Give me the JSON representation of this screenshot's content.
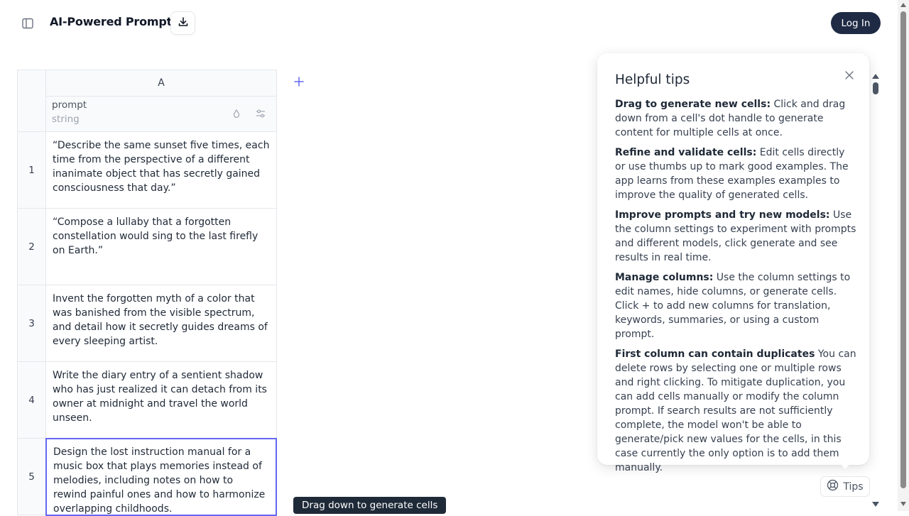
{
  "header": {
    "title": "AI-Powered Prompts",
    "login_label": "Log In"
  },
  "grid": {
    "column": {
      "letter": "A",
      "name": "prompt",
      "type": "string"
    },
    "rows": [
      {
        "num": "1",
        "text": "“Describe the same sunset five times, each time from the perspective of a different inanimate object that has secretly gained consciousness that day.”"
      },
      {
        "num": "2",
        "text": "“Compose a lullaby that a forgotten constellation would sing to the last firefly on Earth.”"
      },
      {
        "num": "3",
        "text": "Invent the forgotten myth of a color that was banished from the visible spectrum, and detail how it secretly guides dreams of every sleeping artist."
      },
      {
        "num": "4",
        "text": "Write the diary entry of a sentient shadow who has just realized it can detach from its owner at midnight and travel the world unseen."
      },
      {
        "num": "5",
        "text": "Design the lost instruction manual for a music box that plays memories instead of melodies, including notes on how to rewind painful ones and how to harmonize overlapping childhoods."
      }
    ],
    "selected_row": 5
  },
  "tooltip": "Drag down to generate cells",
  "tips": {
    "title": "Helpful tips",
    "items": [
      {
        "heading": "Drag to generate new cells:",
        "text": " Click and drag down from a cell's dot handle to generate content for multiple cells at once."
      },
      {
        "heading": "Refine and validate cells:",
        "text": " Edit cells directly or use thumbs up to mark good examples. The app learns from these examples examples to improve the quality of generated cells."
      },
      {
        "heading": "Improve prompts and try new models:",
        "text": " Use the column settings to experiment with prompts and different models, click generate and see results in real time."
      },
      {
        "heading": "Manage columns:",
        "text": " Use the column settings to edit names, hide columns, or generate cells. Click + to add new columns for translation, keywords, summaries, or using a custom prompt."
      },
      {
        "heading": "First column can contain duplicates",
        "text": " You can delete rows by selecting one or multiple rows and right clicking. To mitigate duplication, you can add cells manually or modify the column prompt. If search results are not sufficiently complete, the model won't be able to generate/pick new values for the cells, in this case currently the only option is to add them manually."
      }
    ],
    "button_label": "Tips"
  },
  "colors": {
    "accent": "#6366f1",
    "login_bg": "#1f2a44",
    "tooltip_bg": "#1f2a38"
  },
  "icons": [
    "sidebar-toggle-icon",
    "download-icon",
    "plus-icon",
    "close-icon",
    "droplet-icon",
    "settings-sliders-icon",
    "lifebuoy-icon"
  ]
}
